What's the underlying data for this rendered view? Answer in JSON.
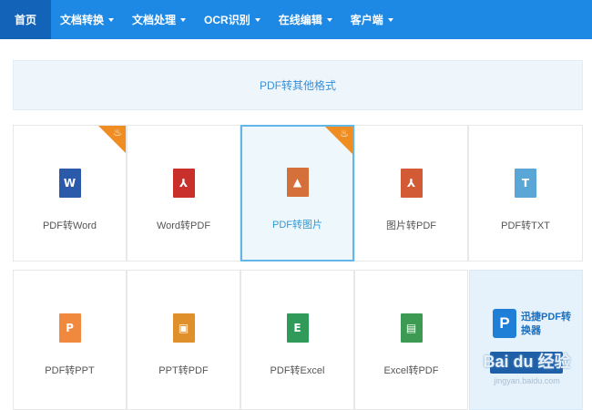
{
  "nav": {
    "items": [
      {
        "label": "首页"
      },
      {
        "label": "文档转换"
      },
      {
        "label": "文档处理"
      },
      {
        "label": "OCR识别"
      },
      {
        "label": "在线编辑"
      },
      {
        "label": "客户端"
      }
    ]
  },
  "banner": {
    "text": "PDF转其他格式"
  },
  "tools": [
    {
      "label": "PDF转Word",
      "glyph": "W",
      "color": "#2b5aab",
      "hot": true
    },
    {
      "label": "Word转PDF",
      "glyph": "⅄",
      "color": "#c9302c",
      "hot": false
    },
    {
      "label": "PDF转图片",
      "glyph": "▲",
      "color": "#d6703a",
      "hot": true,
      "active": true
    },
    {
      "label": "图片转PDF",
      "glyph": "⅄",
      "color": "#d25b36",
      "hot": false
    },
    {
      "label": "PDF转TXT",
      "glyph": "T",
      "color": "#5aa6d6",
      "hot": false
    },
    {
      "label": "PDF转PPT",
      "glyph": "P",
      "color": "#f0883e",
      "hot": false
    },
    {
      "label": "PPT转PDF",
      "glyph": "▣",
      "color": "#e0902a",
      "hot": false
    },
    {
      "label": "PDF转Excel",
      "glyph": "E",
      "color": "#2f9a5a",
      "hot": false
    },
    {
      "label": "Excel转PDF",
      "glyph": "▤",
      "color": "#3d9a52",
      "hot": false
    }
  ],
  "promo": {
    "badge": "P",
    "title": "迅捷PDF转换器",
    "watermark": "Bai du 经验",
    "watermark_sub": "jingyan.baidu.com"
  },
  "icons": {
    "hot": "flame-icon",
    "dropdown": "caret-down-icon"
  }
}
